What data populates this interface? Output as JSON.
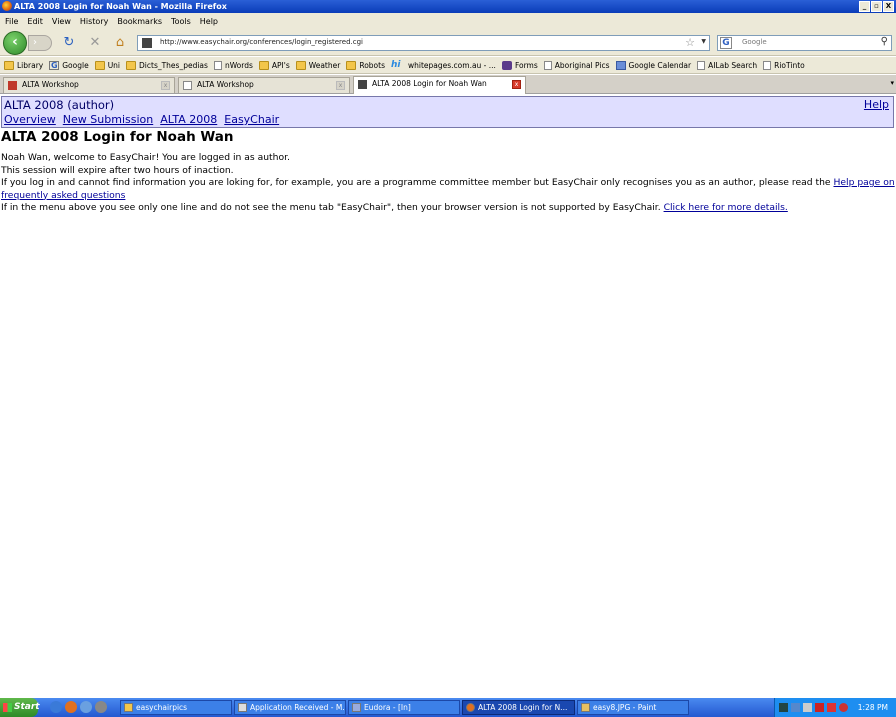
{
  "window": {
    "title": "ALTA 2008 Login for Noah Wan - Mozilla Firefox",
    "buttons": [
      "_",
      "▫",
      "X"
    ]
  },
  "menu": [
    "File",
    "Edit",
    "View",
    "History",
    "Bookmarks",
    "Tools",
    "Help"
  ],
  "nav": {
    "url": "http://www.easychair.org/conferences/login_registered.cgi",
    "search_placeholder": "Google",
    "back": "‹",
    "forward": "›",
    "reload": "↻",
    "stop": "✕",
    "home": "⌂"
  },
  "bookmarks": [
    {
      "label": "Library",
      "icon": "folder"
    },
    {
      "label": "Google",
      "icon": "google"
    },
    {
      "label": "Uni",
      "icon": "folder"
    },
    {
      "label": "Dicts_Thes_pedias",
      "icon": "folder"
    },
    {
      "label": "nWords",
      "icon": "page"
    },
    {
      "label": "API's",
      "icon": "folder"
    },
    {
      "label": "Weather",
      "icon": "folder"
    },
    {
      "label": "Robots",
      "icon": "folder"
    },
    {
      "label": "whitepages.com.au - ...",
      "icon": "hi"
    },
    {
      "label": "Forms",
      "icon": "page"
    },
    {
      "label": "Aboriginal Pics",
      "icon": "page"
    },
    {
      "label": "Google Calendar",
      "icon": "page"
    },
    {
      "label": "AILab Search",
      "icon": "page"
    },
    {
      "label": "RioTinto",
      "icon": "page"
    }
  ],
  "tabs": [
    {
      "label": "ALTA Workshop",
      "active": false
    },
    {
      "label": "ALTA Workshop",
      "active": false
    },
    {
      "label": "ALTA 2008 Login for Noah Wan",
      "active": true
    }
  ],
  "page": {
    "conference": "ALTA 2008 (author)",
    "help": "Help",
    "menu": [
      "Overview",
      "New Submission",
      "ALTA 2008",
      "EasyChair"
    ],
    "heading": "ALTA 2008 Login for Noah Wan",
    "line1": "Noah Wan, welcome to EasyChair! You are logged in as author.",
    "line2": "This session will expire after two hours of inaction.",
    "line3_pre": "If you log in and cannot find information you are loking for, for example, you are a programme committee member but EasyChair only recognises you as an author, please read the ",
    "line3_link": "Help page on frequently asked questions",
    "line4_pre": "If in the menu above you see only one line and do not see the menu tab \"EasyChair\", then your browser version is not supported by EasyChair. ",
    "line4_link": "Click here for more details."
  },
  "taskbar": {
    "start": "Start",
    "tasks": [
      {
        "label": "easychairpics",
        "active": false
      },
      {
        "label": "Application Received - M...",
        "active": false
      },
      {
        "label": "Eudora - [In]",
        "active": false
      },
      {
        "label": "ALTA 2008 Login for N...",
        "active": true
      },
      {
        "label": "easy8.JPG - Paint",
        "active": false
      }
    ],
    "clock": "1:28 PM"
  }
}
